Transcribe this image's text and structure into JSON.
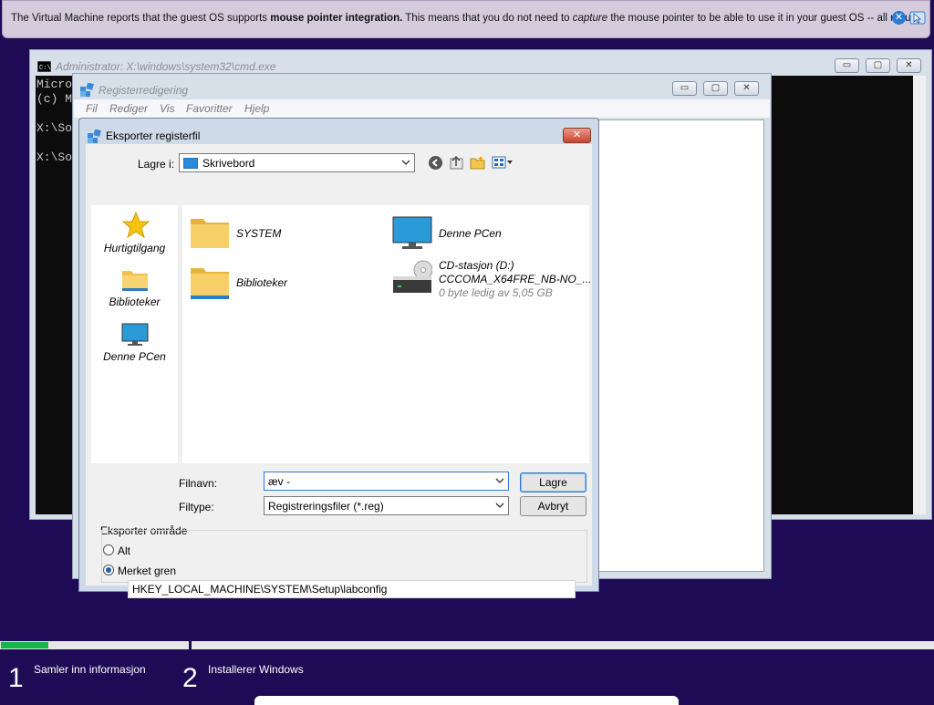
{
  "notification": {
    "text_pre": "The Virtual Machine reports that the guest OS supports ",
    "text_bold": "mouse pointer integration.",
    "text_mid": " This means that you do not need to ",
    "text_italic": "capture",
    "text_post": " the mouse pointer to be able to use it in your guest OS -- all mouse",
    "close_icon": "close-icon",
    "pointer_icon": "mouse-pointer-integration-icon"
  },
  "cmd": {
    "title": "Administrator: X:\\windows\\system32\\cmd.exe",
    "lines": [
      "Micro",
      "(c) M",
      "",
      "X:\\So",
      "",
      "X:\\So"
    ]
  },
  "regedit": {
    "title": "Registerredigering",
    "menu": [
      "Fil",
      "Rediger",
      "Vis",
      "Favoritter",
      "Hjelp"
    ]
  },
  "dialog": {
    "title": "Eksporter registerfil",
    "save_in_label": "Lagre i:",
    "save_in_value": "Skrivebord",
    "places": [
      "Hurtigtilgang",
      "Biblioteker",
      "Denne PCen"
    ],
    "files": [
      {
        "name": "SYSTEM"
      },
      {
        "name": "Denne PCen"
      },
      {
        "name": "Biblioteker"
      },
      {
        "name": "CD-stasjon (D:)",
        "line2": "CCCOMA_X64FRE_NB-NO_...",
        "line3": "0 byte ledig av 5,05 GB"
      }
    ],
    "filename_label": "Filnavn:",
    "filename_value": "æv -",
    "filetype_label": "Filtype:",
    "filetype_value": "Registreringsfiler (*.reg)",
    "save_button": "Lagre",
    "cancel_button": "Avbryt",
    "export_range_label": "Eksporter område",
    "radio_all": "Alt",
    "radio_selected": "Merket gren",
    "selected_branch": "HKEY_LOCAL_MACHINE\\SYSTEM\\Setup\\labconfig"
  },
  "setup": {
    "progress": 0.25,
    "steps": [
      {
        "number": "1",
        "label": "Samler inn informasjon"
      },
      {
        "number": "2",
        "label": "Installerer Windows"
      }
    ]
  },
  "colors": {
    "background": "#1e0a55",
    "progress": "#17b54a",
    "accent": "#2e7ad1"
  }
}
